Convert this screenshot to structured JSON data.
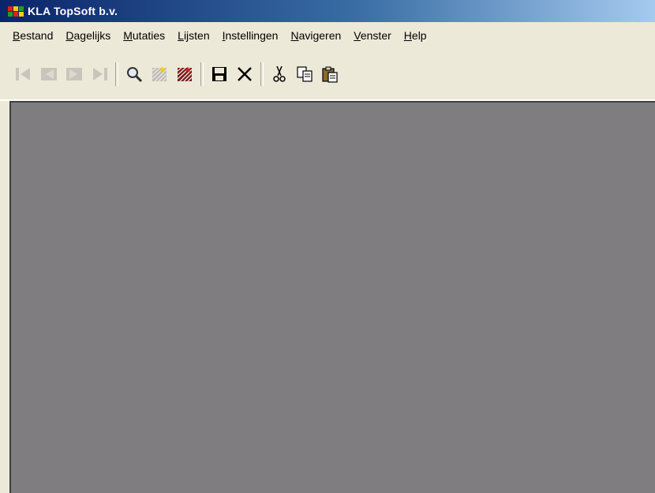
{
  "window": {
    "title": "KLA TopSoft b.v.",
    "app_icon": "kla-logo-icon"
  },
  "menubar": {
    "items": [
      {
        "label": "Bestand",
        "accel": "B",
        "rest": "estand"
      },
      {
        "label": "Dagelijks",
        "accel": "D",
        "rest": "agelijks"
      },
      {
        "label": "Mutaties",
        "accel": "M",
        "rest": "utaties"
      },
      {
        "label": "Lijsten",
        "accel": "L",
        "rest": "ijsten"
      },
      {
        "label": "Instellingen",
        "accel": "I",
        "rest": "nstellingen"
      },
      {
        "label": "Navigeren",
        "accel": "N",
        "rest": "avigeren"
      },
      {
        "label": "Venster",
        "accel": "V",
        "rest": "enster"
      },
      {
        "label": "Help",
        "accel": "H",
        "rest": "elp"
      }
    ]
  },
  "toolbar": {
    "buttons": [
      {
        "icon": "first-record-icon",
        "enabled": false
      },
      {
        "icon": "previous-record-icon",
        "enabled": false
      },
      {
        "icon": "next-record-icon",
        "enabled": false
      },
      {
        "icon": "last-record-icon",
        "enabled": false
      },
      {
        "icon": "search-icon",
        "enabled": true
      },
      {
        "icon": "new-record-icon",
        "enabled": false
      },
      {
        "icon": "delete-record-icon",
        "enabled": true
      },
      {
        "icon": "save-icon",
        "enabled": true
      },
      {
        "icon": "cancel-icon",
        "enabled": true
      },
      {
        "icon": "cut-icon",
        "enabled": true
      },
      {
        "icon": "copy-icon",
        "enabled": true
      },
      {
        "icon": "paste-icon",
        "enabled": true
      }
    ]
  },
  "colors": {
    "titlebar_start": "#0a246a",
    "workspace": "#807d81",
    "chrome": "#ece9d8"
  }
}
